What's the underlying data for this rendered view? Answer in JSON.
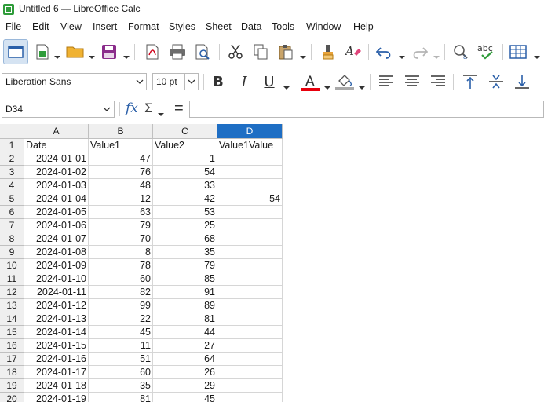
{
  "window": {
    "title": "Untitled 6 — LibreOffice Calc"
  },
  "menu": [
    "File",
    "Edit",
    "View",
    "Insert",
    "Format",
    "Styles",
    "Sheet",
    "Data",
    "Tools",
    "Window",
    "Help"
  ],
  "font": {
    "name": "Liberation Sans",
    "size": "10 pt"
  },
  "namebox": {
    "value": "D34"
  },
  "formula": {
    "value": ""
  },
  "columns": [
    "A",
    "B",
    "C",
    "D"
  ],
  "selected_column": "D",
  "rows": [
    [
      "Date",
      "Value1",
      "Value2",
      "Value1Value"
    ],
    [
      "2024-01-01",
      "47",
      "1",
      ""
    ],
    [
      "2024-01-02",
      "76",
      "54",
      ""
    ],
    [
      "2024-01-03",
      "48",
      "33",
      ""
    ],
    [
      "2024-01-04",
      "12",
      "42",
      "54"
    ],
    [
      "2024-01-05",
      "63",
      "53",
      ""
    ],
    [
      "2024-01-06",
      "79",
      "25",
      ""
    ],
    [
      "2024-01-07",
      "70",
      "68",
      ""
    ],
    [
      "2024-01-08",
      "8",
      "35",
      ""
    ],
    [
      "2024-01-09",
      "78",
      "79",
      ""
    ],
    [
      "2024-01-10",
      "60",
      "85",
      ""
    ],
    [
      "2024-01-11",
      "82",
      "91",
      ""
    ],
    [
      "2024-01-12",
      "99",
      "89",
      ""
    ],
    [
      "2024-01-13",
      "22",
      "81",
      ""
    ],
    [
      "2024-01-14",
      "45",
      "44",
      ""
    ],
    [
      "2024-01-15",
      "11",
      "27",
      ""
    ],
    [
      "2024-01-16",
      "51",
      "64",
      ""
    ],
    [
      "2024-01-17",
      "60",
      "26",
      ""
    ],
    [
      "2024-01-18",
      "35",
      "29",
      ""
    ],
    [
      "2024-01-19",
      "81",
      "45",
      ""
    ]
  ],
  "colors": {
    "selection": "#1e6ec4",
    "font_color_bar": "#e8000d",
    "highlight_bar": "#a9a9a9"
  }
}
